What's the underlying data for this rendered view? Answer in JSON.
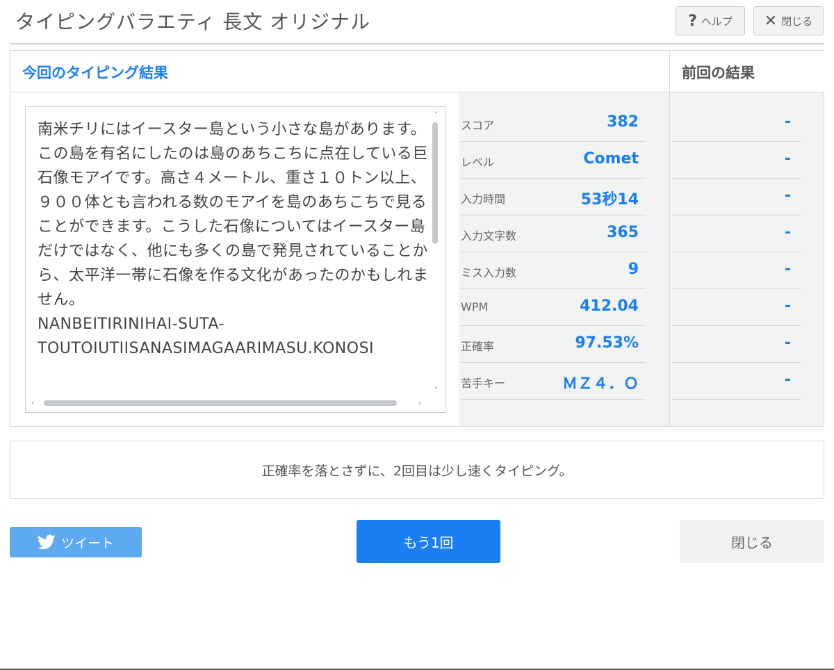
{
  "header": {
    "title": "タイピングバラエティ 長文 オリジナル",
    "help_label": "ヘルプ",
    "close_label": "閉じる"
  },
  "results": {
    "current_title": "今回のタイピング結果",
    "previous_title": "前回の結果",
    "text_jp": "南米チリにはイースター島という小さな島があります。この島を有名にしたのは島のあちこちに点在している巨石像モアイです。高さ４メートル、重さ１０トン以上、９００体とも言われる数のモアイを島のあちこちで見ることができます。こうした石像についてはイースター島だけではなく、他にも多くの島で発見されていることから、太平洋一帯に石像を作る文化があったのかもしれません。",
    "text_roman": "NANBEITIRINIHAI-SUTA-\nTOUTOIUTIISANASIMAGAARIMASU.KONOSI",
    "stats": [
      {
        "label": "スコア",
        "value": "382",
        "previous": "-"
      },
      {
        "label": "レベル",
        "value": "Comet",
        "previous": "-"
      },
      {
        "label": "入力時間",
        "value": "53秒14",
        "previous": "-"
      },
      {
        "label": "入力文字数",
        "value": "365",
        "previous": "-"
      },
      {
        "label": "ミス入力数",
        "value": "9",
        "previous": "-"
      },
      {
        "label": "WPM",
        "value": "412.04",
        "previous": "-"
      },
      {
        "label": "正確率",
        "value": "97.53%",
        "previous": "-"
      },
      {
        "label": "苦手キー",
        "value": "ＭＺ４．Ｏ",
        "previous": "-"
      }
    ]
  },
  "advice": "正確率を落とさずに、2回目は少し速くタイピング。",
  "actions": {
    "tweet_label": "ツイート",
    "retry_label": "もう1回",
    "close_label": "閉じる"
  },
  "colors": {
    "accent": "#1a7ff5",
    "tweet": "#5eaaf0",
    "panel_gray": "#f2f3f3"
  }
}
